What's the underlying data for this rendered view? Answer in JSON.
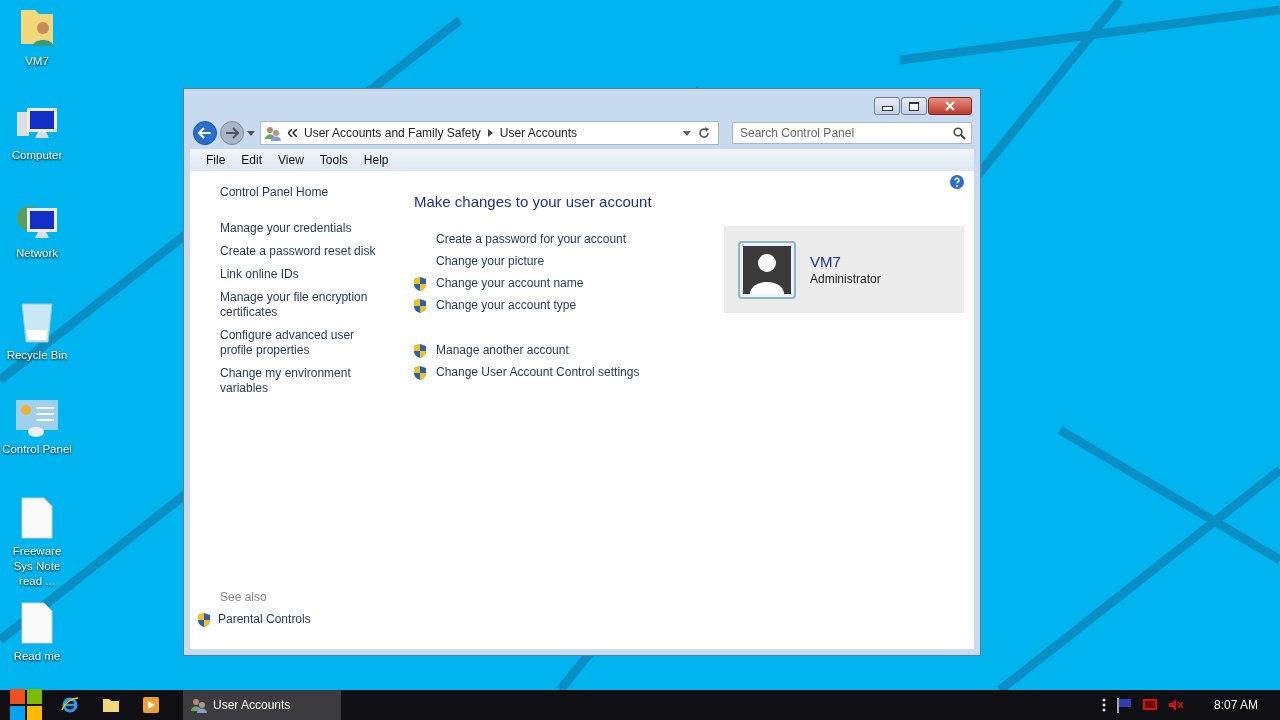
{
  "desktop_icons": [
    {
      "label": "VM7",
      "kind": "user-folder"
    },
    {
      "label": "Computer",
      "kind": "computer"
    },
    {
      "label": "Network",
      "kind": "network"
    },
    {
      "label": "Recycle Bin",
      "kind": "recycle"
    },
    {
      "label": "Control Panel",
      "kind": "control-panel"
    },
    {
      "label": "Freeware Sys Note read ...",
      "kind": "document"
    },
    {
      "label": "Read me",
      "kind": "document"
    }
  ],
  "window": {
    "address": {
      "crumbs": [
        "User Accounts and Family Safety",
        "User Accounts"
      ]
    },
    "search": {
      "placeholder": "Search Control Panel"
    },
    "menu": [
      "File",
      "Edit",
      "View",
      "Tools",
      "Help"
    ],
    "sidebar": {
      "home": "Control Panel Home",
      "items": [
        "Manage your credentials",
        "Create a password reset disk",
        "Link online IDs",
        "Manage your file encryption certificates",
        "Configure advanced user profile properties",
        "Change my environment variables"
      ],
      "see_also": {
        "heading": "See also",
        "items": [
          {
            "label": "Parental Controls",
            "shield": true
          }
        ]
      }
    },
    "main": {
      "heading": "Make changes to your user account",
      "task_groups": [
        [
          {
            "label": "Create a password for your account",
            "shield": false
          },
          {
            "label": "Change your picture",
            "shield": false
          },
          {
            "label": "Change your account name",
            "shield": true
          },
          {
            "label": "Change your account type",
            "shield": true
          }
        ],
        [
          {
            "label": "Manage another account",
            "shield": true
          },
          {
            "label": "Change User Account Control settings",
            "shield": true
          }
        ]
      ],
      "account": {
        "name": "VM7",
        "role": "Administrator"
      }
    }
  },
  "taskbar": {
    "apps": [
      {
        "kind": "ie"
      },
      {
        "kind": "explorer"
      },
      {
        "kind": "media"
      }
    ],
    "window_button": {
      "label": "User Accounts",
      "selected": true
    },
    "clock": "8:07 AM"
  }
}
